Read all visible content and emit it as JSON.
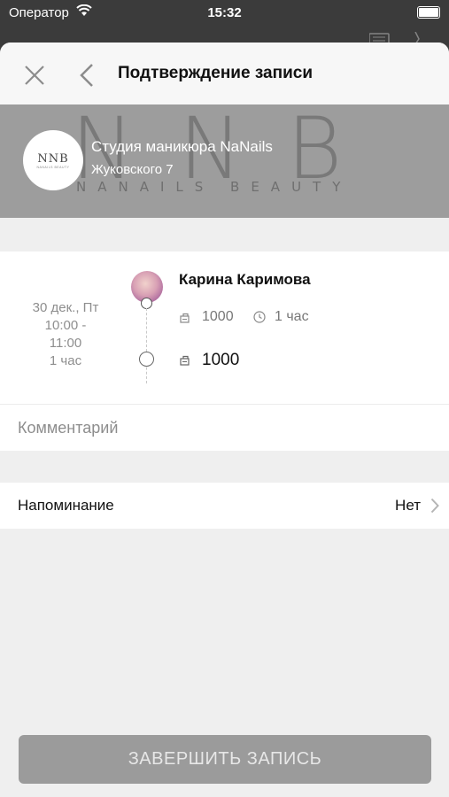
{
  "status_bar": {
    "carrier": "Оператор",
    "time": "15:32"
  },
  "header": {
    "title": "Подтверждение записи"
  },
  "studio": {
    "name": "Студия маникюра NaNails",
    "address": "Жуковского 7",
    "logo_text": "NNB",
    "logo_subtext": "NANAILS BEAUTY",
    "banner_letters": "NNB",
    "banner_subtext": "NANAILS BEAUTY"
  },
  "booking": {
    "date": "30 дек., Пт",
    "time_start": "10:00 -",
    "time_end": "11:00",
    "duration": "1 час",
    "master": "Карина Каримова",
    "service_price": "1000",
    "service_duration": "1 час",
    "total_price": "1000"
  },
  "comment": {
    "placeholder": "Комментарий"
  },
  "reminder": {
    "label": "Напоминание",
    "value": "Нет"
  },
  "footer": {
    "finish_label": "ЗАВЕРШИТЬ ЗАПИСЬ"
  },
  "colors": {
    "sheet_bg": "#efefef",
    "banner_bg": "#9d9d9d",
    "button_bg": "#9b9b9b",
    "status_bg": "#3b3b3b"
  }
}
